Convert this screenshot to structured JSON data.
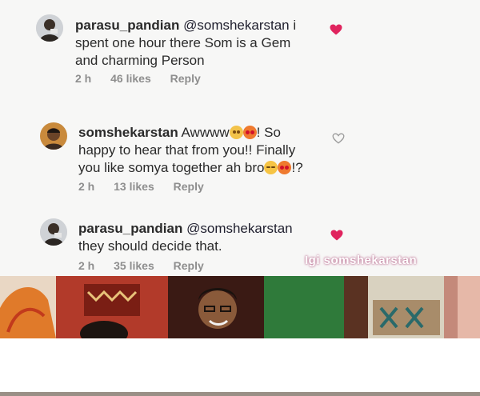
{
  "comments": [
    {
      "username": "parasu_pandian",
      "mention": "@somshekarstan",
      "line1_tail": " i",
      "line2": "spent one hour there Som is a Gem",
      "line3": "and charming Person",
      "time": "2 h",
      "likes": "46 likes",
      "reply": "Reply",
      "liked": true
    },
    {
      "username": "somshekarstan",
      "line1": " Awwww",
      "line1_tail": "! So",
      "line2": "happy to hear that from you!! Finally",
      "line3": "you like somya together ah bro",
      "line3_tail": "!?",
      "time": "2 h",
      "likes": "13 likes",
      "reply": "Reply",
      "liked": false
    },
    {
      "username": "parasu_pandian",
      "mention": "@somshekarstan",
      "line2": "they should decide that.",
      "time": "2 h",
      "likes": "35 likes",
      "reply": "Reply",
      "liked": true
    }
  ],
  "watermark": "Igi somshekarstan",
  "colors": {
    "heart_liked": "#e0245e",
    "heart_outline": "#9a9a9a",
    "meta": "#8e8e8e"
  },
  "icons": {
    "like": "heart-icon"
  }
}
